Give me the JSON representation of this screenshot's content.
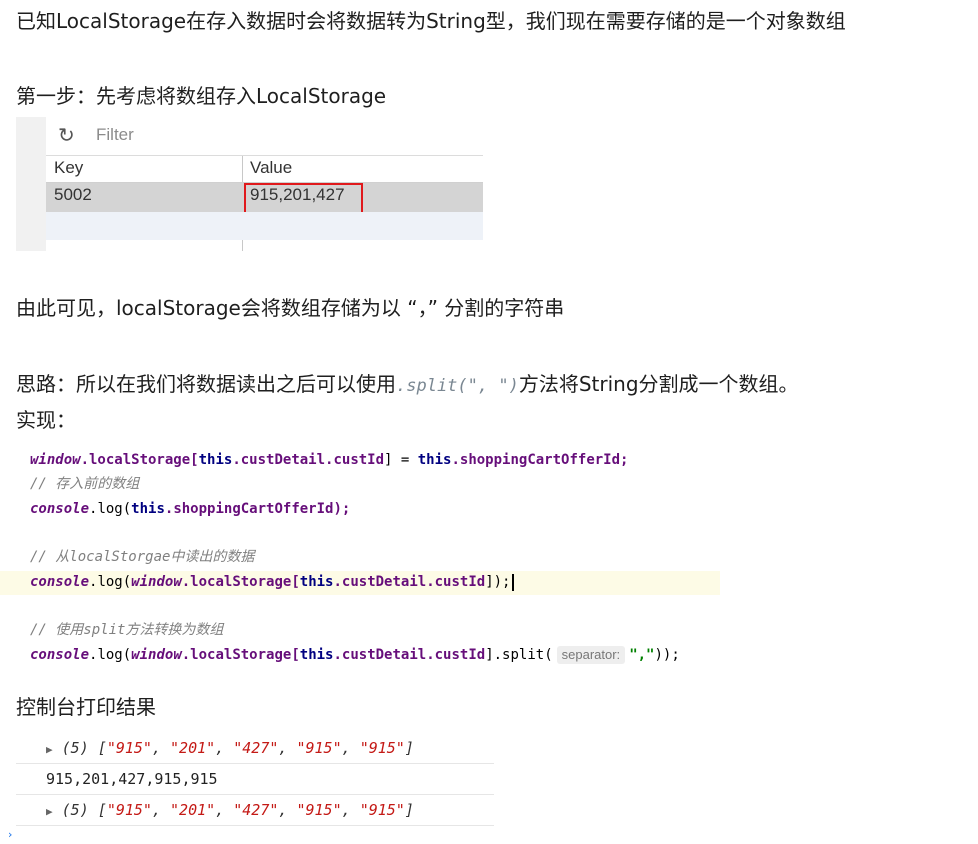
{
  "intro": "已知LocalStorage在存入数据时会将数据转为String型，我们现在需要存储的是一个对象数组",
  "step1": "第一步：先考虑将数组存入LocalStorage",
  "storage_panel": {
    "filter_placeholder": "Filter",
    "col_key": "Key",
    "col_value": "Value",
    "row_key": "5002",
    "row_value": "915,201,427"
  },
  "observation": "由此可见，localStorage会将数组存储为以 “，” 分割的字符串",
  "idea_prefix": "思路：所以在我们将数据读出之后可以使用",
  "idea_code": ".split(\", \")",
  "idea_suffix": "方法将String分割成一个数组。",
  "impl_label": "实现：",
  "code": {
    "l1_window": "window",
    "l1_a": ".localStorage[",
    "l1_this": "this",
    "l1_b": ".custDetail.custId",
    "l1_c": "] = ",
    "l1_this2": "this",
    "l1_d": ".shoppingCartOfferId;",
    "c1": "// 存入前的数组",
    "l2_console": "console",
    "l2_a": ".log(",
    "l2_this": "this",
    "l2_b": ".shoppingCartOfferId);",
    "c2": "// 从localStorgae中读出的数据",
    "l3_console": "console",
    "l3_a": ".log(",
    "l3_window": "window",
    "l3_b": ".localStorage[",
    "l3_this": "this",
    "l3_c": ".custDetail.custId",
    "l3_d": "]);",
    "c3": "// 使用split方法转换为数组",
    "l4_console": "console",
    "l4_a": ".log(",
    "l4_window": "window",
    "l4_b": ".localStorage[",
    "l4_this": "this",
    "l4_c": ".custDetail.custId",
    "l4_d": "].split(",
    "l4_hint": "separator:",
    "l4_str": "\",\"",
    "l4_e": "));"
  },
  "console_label": "控制台打印结果",
  "console": {
    "arr1_prefix": "(5) [",
    "arr1_items": [
      "\"915\"",
      "\"201\"",
      "\"427\"",
      "\"915\"",
      "\"915\""
    ],
    "sep": ", ",
    "close": "]",
    "plain_line": "915,201,427,915,915",
    "arr2_prefix": "(5) [",
    "arr2_items": [
      "\"915\"",
      "\"201\"",
      "\"427\"",
      "\"915\"",
      "\"915\""
    ]
  }
}
